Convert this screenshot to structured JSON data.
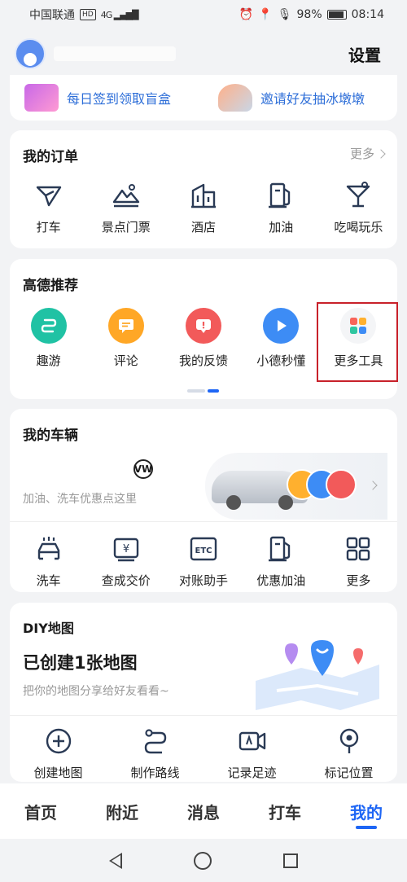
{
  "status_bar": {
    "carrier": "中国联通",
    "hd": "HD",
    "network": "4G",
    "battery": "98%",
    "time": "08:14"
  },
  "header": {
    "settings_label": "设置"
  },
  "promo": {
    "items": [
      {
        "label": "每日签到领取盲盒",
        "icon": "gift-box-icon"
      },
      {
        "label": "邀请好友抽冰墩墩",
        "icon": "mascot-icon"
      }
    ]
  },
  "orders": {
    "title": "我的订单",
    "more": "更多",
    "items": [
      {
        "label": "打车",
        "icon": "taxi-arrow-icon"
      },
      {
        "label": "景点门票",
        "icon": "scenic-ticket-icon"
      },
      {
        "label": "酒店",
        "icon": "hotel-icon"
      },
      {
        "label": "加油",
        "icon": "fuel-icon"
      },
      {
        "label": "吃喝玩乐",
        "icon": "cocktail-icon"
      }
    ]
  },
  "recommend": {
    "title": "高德推荐",
    "items": [
      {
        "label": "趣游",
        "icon": "route-icon",
        "color": "#20c2a4"
      },
      {
        "label": "评论",
        "icon": "comment-icon",
        "color": "#ffa726"
      },
      {
        "label": "我的反馈",
        "icon": "feedback-icon",
        "color": "#f25a5a"
      },
      {
        "label": "小德秒懂",
        "icon": "play-icon",
        "color": "#3d8cf5"
      },
      {
        "label": "更多工具",
        "icon": "apps-grid-icon",
        "color": "#f4f5f7"
      }
    ]
  },
  "vehicle": {
    "title": "我的车辆",
    "brand_logo": "VW",
    "subtitle": "加油、洗车优惠点这里",
    "tools": [
      {
        "label": "洗车",
        "icon": "car-wash-icon"
      },
      {
        "label": "查成交价",
        "icon": "price-tag-icon"
      },
      {
        "label": "对账助手",
        "icon": "etc-icon"
      },
      {
        "label": "优惠加油",
        "icon": "fuel-discount-icon"
      },
      {
        "label": "更多",
        "icon": "grid-more-icon"
      }
    ]
  },
  "diy": {
    "title": "DIY地图",
    "heading": "已创建1张地图",
    "subtitle": "把你的地图分享给好友看看~",
    "actions": [
      {
        "label": "创建地图",
        "icon": "plus-circle-icon"
      },
      {
        "label": "制作路线",
        "icon": "route-make-icon"
      },
      {
        "label": "记录足迹",
        "icon": "video-record-icon"
      },
      {
        "label": "标记位置",
        "icon": "location-pin-icon"
      }
    ]
  },
  "tabs": [
    {
      "label": "首页"
    },
    {
      "label": "附近"
    },
    {
      "label": "消息"
    },
    {
      "label": "打车"
    },
    {
      "label": "我的",
      "active": true
    }
  ],
  "colors": {
    "accent": "#1e66f5",
    "link": "#2d6ed8",
    "highlight": "#c8212a"
  }
}
